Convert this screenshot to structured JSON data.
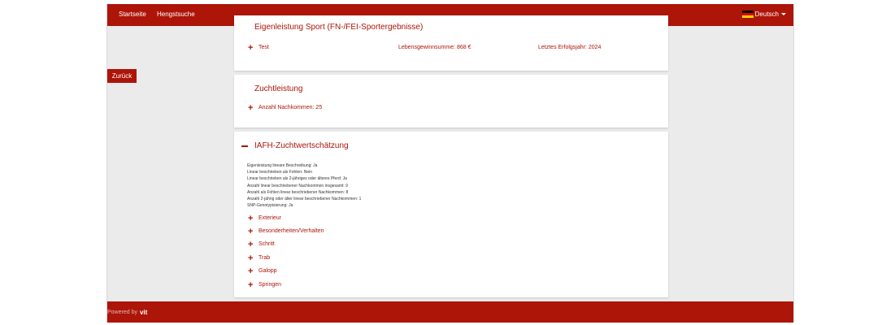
{
  "nav": {
    "items": [
      {
        "label": "Startseite"
      },
      {
        "label": "Hengstsuche"
      }
    ],
    "language": "Deutsch",
    "language_icon": "german-flag-icon"
  },
  "back_button": "Zurück",
  "sport_card": {
    "title": "Eigenleistung Sport (FN-/FEI-Sportergebnisse)",
    "row_label": "Test",
    "lifetime_winnings": "Lebensgewinnsumme: 868 €",
    "last_success_year": "Letztes Erfolgsjahr: 2024"
  },
  "breeding_card": {
    "title": "Zuchtleistung",
    "offspring": "Anzahl Nachkommen: 25"
  },
  "iafh_card": {
    "title": "IAFH-Zuchtwertschätzung",
    "info_lines": [
      "Eigenleistung lineare Beschreibung: Ja",
      "Linear beschrieben als Fohlen: Nein",
      "Linear beschrieben als 2-jähriges oder älteres Pferd: Ja",
      "Anzahl linear beschriebener Nachkommen insgesamt: 9",
      "Anzahl als Fohlen linear beschriebener Nachkommen: 8",
      "Anzahl 2-jährig oder älter linear beschriebener Nachkommen: 1",
      "SNP-Genotypisierung: Ja"
    ],
    "sections": [
      {
        "label": "Exterieur"
      },
      {
        "label": "Besonderheiten/Verhalten"
      },
      {
        "label": "Schritt"
      },
      {
        "label": "Trab"
      },
      {
        "label": "Galopp"
      },
      {
        "label": "Springen"
      }
    ]
  },
  "footer": {
    "powered_by": "Powered by",
    "brand": "vit"
  },
  "colors": {
    "brand_red": "#ac1508",
    "page_bg": "#ebebeb"
  }
}
